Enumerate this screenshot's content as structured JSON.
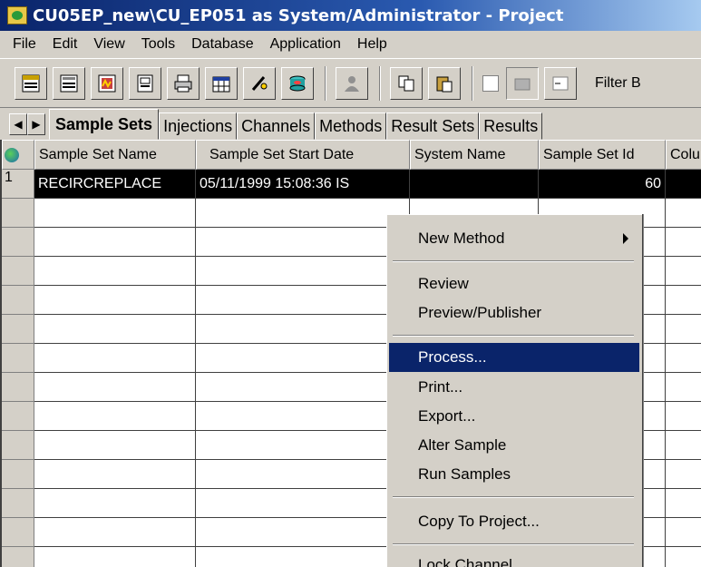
{
  "window": {
    "title": "CU05EP_new\\CU_EP051 as System/Administrator - Project",
    "icon": "project-icon"
  },
  "menubar": {
    "items": [
      "File",
      "Edit",
      "View",
      "Tools",
      "Database",
      "Application",
      "Help"
    ]
  },
  "toolbar": {
    "buttons": [
      "sample-sets-icon",
      "injections-icon",
      "channels-icon",
      "methods-icon",
      "print-icon",
      "table-icon",
      "pen-icon",
      "database-icon",
      "person-icon",
      "copy-icon",
      "paste-icon"
    ],
    "filter_label": "Filter B"
  },
  "tabs": {
    "items": [
      "Sample Sets",
      "Injections",
      "Channels",
      "Methods",
      "Result Sets",
      "Results"
    ],
    "active": "Sample Sets"
  },
  "grid": {
    "columns": [
      "Sample Set Name",
      "Sample Set Start Date",
      "System Name",
      "Sample Set Id",
      "Colu"
    ],
    "rows": [
      {
        "num": "1",
        "name": "RECIRCREPLACE",
        "start_date": "05/11/1999 15:08:36 IS",
        "system": "",
        "id": "60",
        "column": ""
      }
    ]
  },
  "context_menu": {
    "items": [
      "New Method",
      "Review",
      "Preview/Publisher",
      "Process...",
      "Print...",
      "Export...",
      "Alter Sample",
      "Run Samples",
      "Copy To Project...",
      "Lock Channel"
    ],
    "highlighted": "Process..."
  },
  "colors": {
    "title_active": "#0a246a",
    "selection": "#0a246a",
    "face": "#d4d0c8"
  }
}
